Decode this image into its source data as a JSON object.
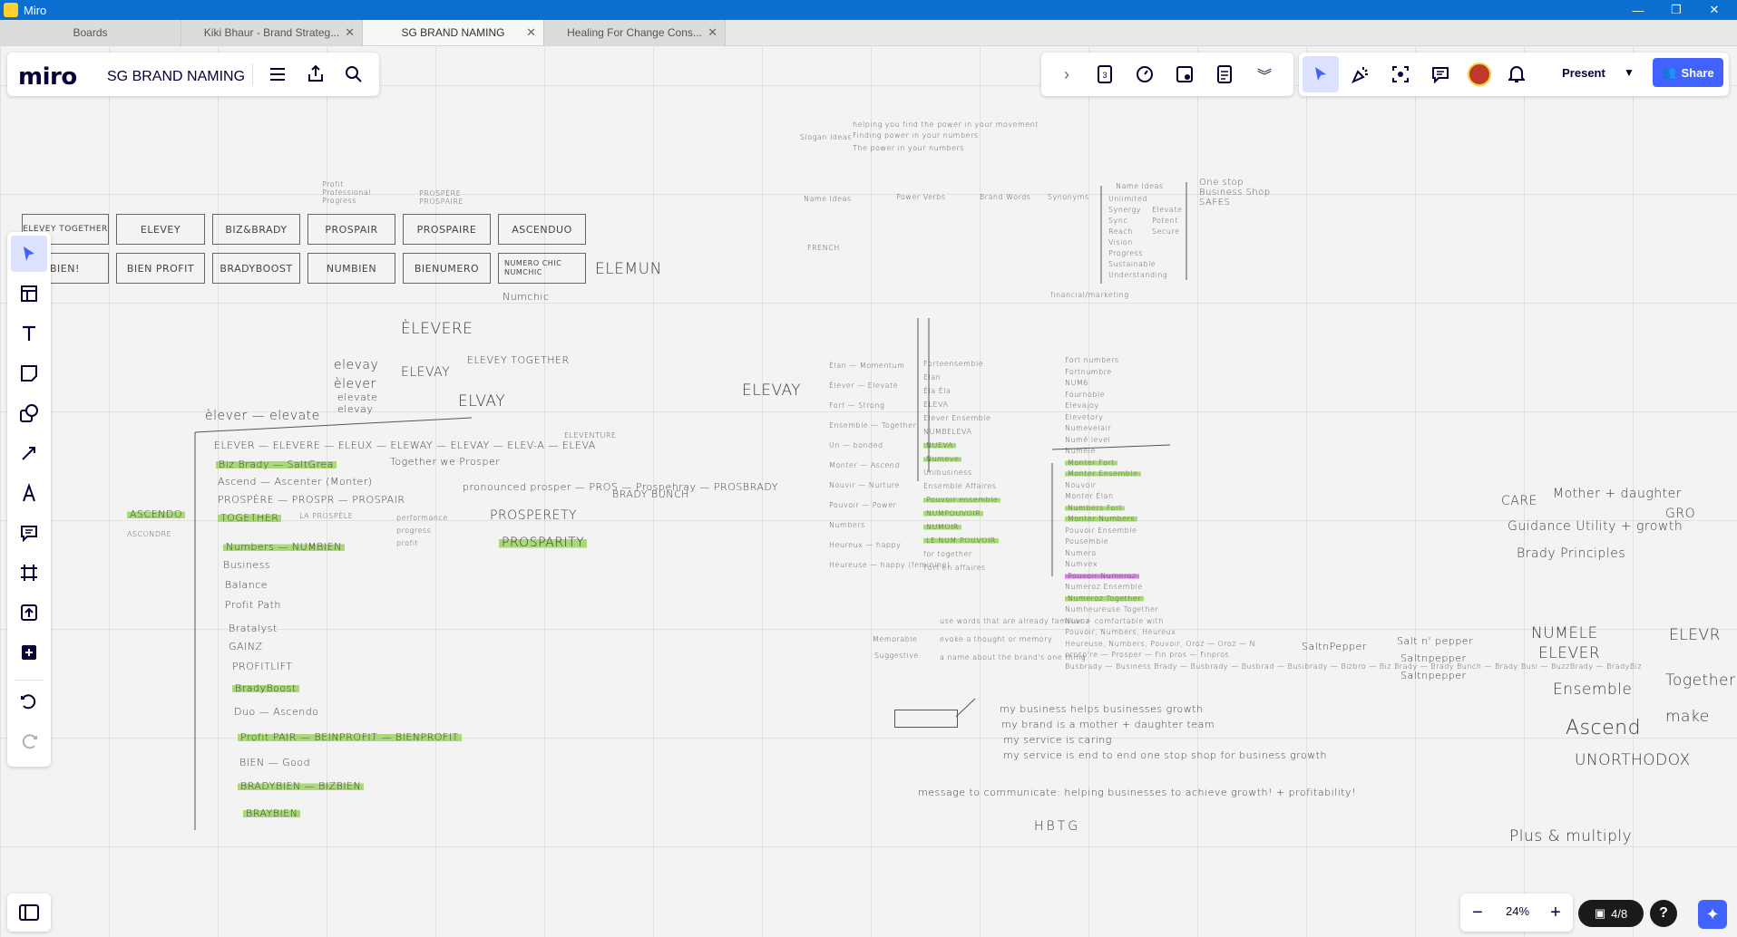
{
  "window": {
    "title": "Miro"
  },
  "tabs": [
    {
      "label": "Boards",
      "active": false,
      "closable": false
    },
    {
      "label": "Kiki Bhaur - Brand Strateg...",
      "active": false,
      "closable": true
    },
    {
      "label": "SG BRAND NAMING",
      "active": true,
      "closable": true
    },
    {
      "label": "Healing For Change Cons...",
      "active": false,
      "closable": true
    }
  ],
  "header": {
    "logo": "miro",
    "board_title": "SG BRAND NAMING"
  },
  "topbar": {
    "present_label": "Present",
    "share_label": "Share"
  },
  "bottombar": {
    "zoom": "24%",
    "frames": "4/8",
    "help": "?"
  },
  "colors": {
    "accent": "#4262ff",
    "highlight_green": "#9dd662",
    "highlight_purple": "#cd6edc",
    "titlebar": "#0a6fd0"
  },
  "board": {
    "boxes_row1": [
      "ELEVEY TOGETHER",
      "ELEVEY",
      "BIZ&BRADY",
      "PROSPAIR",
      "PROSPAIRE",
      "ASCENDUO"
    ],
    "boxes_row2": [
      "BIEN!",
      "BIEN PROFIT",
      "BRADYBOOST",
      "NUMBIEN",
      "BIENUMERO",
      "NUMERO CHIC NUMCHIC"
    ],
    "box_notes": [
      "Numchic",
      "ELEMUN",
      "Profit Professional Progress",
      "PROSPÈRE PROSPAIRE"
    ],
    "left_cluster": {
      "top": [
        "ÈLEVERE",
        "elevay",
        "èlever",
        "elevate",
        "elevay",
        "ELEVAY",
        "ELEVEY TOGETHER",
        "ELVAY",
        "èlever — elevate"
      ],
      "tree": [
        "ELEVER — ELEVERE — ELEUX — ELEWAY — ELEVAY — ELEV-A — ELEVA",
        "ELEVENTURE",
        "Biz Brady — SaltGrea",
        "Together we Prosper",
        "Ascend — Ascenter (Monter)",
        "PROSPÈRE — PROSPR — PROSPAIR",
        "pronounced prosper — PROS — Prospehray — PROSBRADY",
        "BRADY BUNCH",
        "LA PROSPÈLE",
        "TOGETHER",
        "Numbers — NUMBIEN",
        "performance",
        "progress",
        "profit",
        "PROSPERETY",
        "PROSPARITY",
        "Business",
        "Balance",
        "Profit Path",
        "Bratalyst",
        "GAINZ",
        "PROFITLIFT",
        "BradyBoost",
        "Duo — Ascendo",
        "Profit PAIR — BEINPROFIT — BIENPROFIT",
        "BIEN — Good",
        "BRADYBIEN — BIZBIEN",
        "BRAYBIEN",
        "ASCENDO",
        "ASCONDRE"
      ]
    },
    "mid_cluster": {
      "tagline_ideas": [
        "Slogan Ideas",
        "helping you find the power in your movement",
        "Finding power in your numbers",
        "The power in your numbers"
      ],
      "small_lists": [
        "Name Ideas",
        "Power Verbs",
        "Brand Words",
        "Synonyms",
        "FRENCH"
      ],
      "elevay": "ELEVAY",
      "column1": [
        "Élan — Momentum",
        "Élever — Elevate",
        "Fort — Strong",
        "Ensemble — Together",
        "Un — bonded",
        "Monter — Ascend",
        "Nouvir — Nurture",
        "Pouvoir — Power",
        "Numbers",
        "Heureux — happy",
        "Heureuse — happy (feminine)"
      ],
      "column2": [
        "Forteensemble",
        "Elan",
        "Èla Èla",
        "ELEVA",
        "Elever Ensemble",
        "NUMBELEVA",
        "NUEVA",
        "Numeve",
        "Unibusiness",
        "Ensemble Affaires",
        "Pouvoir ensemble",
        "NUMPOUVOIR",
        "NUMOIR",
        "LE NUM POUVOIR",
        "for together",
        "Fort en affaires"
      ],
      "column3": [
        "Fort numbers",
        "Fortnumbre",
        "NUM6",
        "Fournoble",
        "Elevajoy",
        "Elevetory",
        "Numevelair",
        "Numé level",
        "Numèle",
        "Monter Fort",
        "Monter Ensemble",
        "Nouvoir",
        "Monter Élan",
        "Numbers Fort",
        "Monter Numbers",
        "Pouvoir Ensemble",
        "Pousemble",
        "Numero",
        "Numvex",
        "Pouvoir Numeroz",
        "Numeroz Ensemble",
        "Numeroz Together",
        "Numheureuse Together",
        "Nuvoz",
        "Pouvoir, Numbers, Heureux",
        "Heureuse, Numbers, Pouvoir, Oroz — Oroz — N",
        "prosp're — Prosper — Fin pros — Finpros",
        "Busbrady — Business Brady — Busbrady — Busbrad — Busibrady — Bizbro — Biz Brady — Brady Bunch — Brady Busi — BuzzBrady — BradyBiz"
      ],
      "name_ideas": [
        "Name Ideas",
        "Unlimited",
        "Synergy",
        "Sync",
        "Reach",
        "Vision",
        "Elevate",
        "Potent",
        "Secure",
        "Progress",
        "Sustainable",
        "Understanding",
        "One stop Business Shop SAFES",
        "financial/marketing"
      ]
    },
    "bottom_notes": [
      "Memorable",
      "Suggestive",
      "use words that are already familiar + comfortable with",
      "evoke a thought or memory",
      "a name about the brand's one thing",
      "SaltnPepper",
      "Salt n' pepper",
      "Saltnpepper",
      "Saltnpepper",
      "my business helps businesses growth",
      "my brand is a mother + daughter team",
      "my service is caring",
      "my service is end to end one stop shop for business growth",
      "message to communicate: helping businesses to achieve growth! + profitability!",
      "HBTG"
    ],
    "right_notes": [
      "CARE",
      "Mother + daughter",
      "Guidance Utility + growth",
      "GRO",
      "Brady Principles",
      "NUMELE",
      "ELEVER",
      "ELEVR",
      "Ensemble",
      "Together",
      "Ascend",
      "make",
      "UNORTHODOX",
      "Plus & multiply"
    ]
  }
}
